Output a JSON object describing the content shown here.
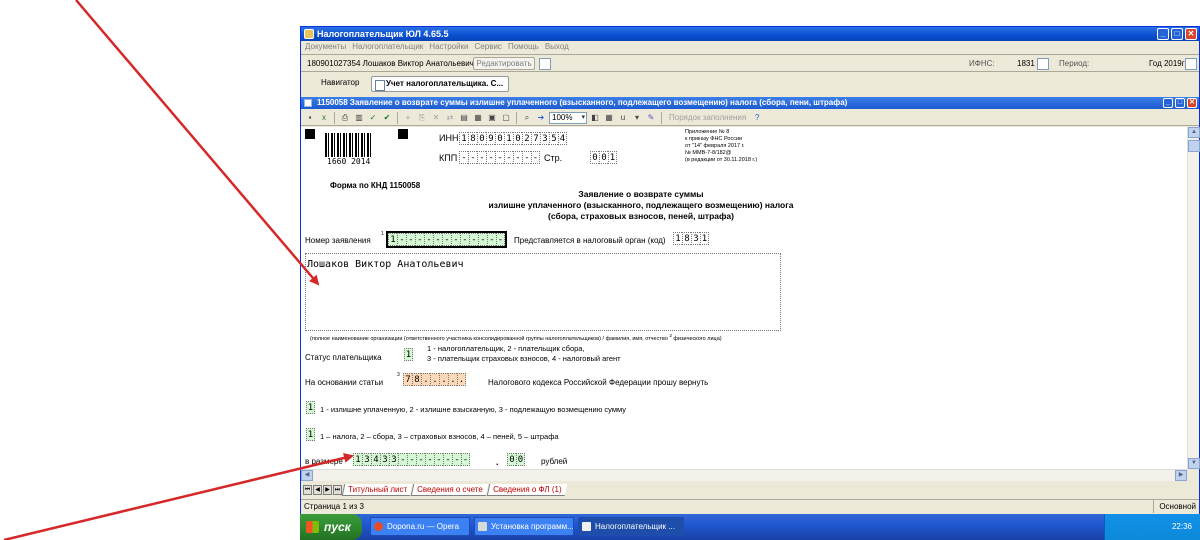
{
  "window": {
    "title": "Налогоплательщик ЮЛ 4.65.5",
    "min": "_",
    "max": "□",
    "close": "✕"
  },
  "menu": [
    "Документы",
    "Налогоплательщик",
    "Настройки",
    "Сервис",
    "Помощь",
    "Выход"
  ],
  "infobar": {
    "user": "180901027354 Лошаков Виктор Анатольевич",
    "edit_label": "Редактировать",
    "ifns_label": "ИФНС:",
    "ifns_value": "1831",
    "period_label": "Период:",
    "period_value": "Год 2019г"
  },
  "nav": {
    "navigator": "Навигатор",
    "active_tab": "Учет налогоплательщика. С..."
  },
  "doc": {
    "title": "1150058 Заявление о возврате суммы излишне уплаченного (взысканного, подлежащего возмещению) налога (сбора, пени, штрафа)",
    "zoom": "100%",
    "fill_order": "Порядок заполнения"
  },
  "form": {
    "barcode_number": "1660 2014",
    "inn_label": "ИНН",
    "inn": [
      "1",
      "8",
      "0",
      "9",
      "0",
      "1",
      "0",
      "2",
      "7",
      "3",
      "5",
      "4"
    ],
    "kpp_label": "КПП",
    "kpp": [
      "-",
      "-",
      "-",
      "-",
      "-",
      "-",
      "-",
      "-",
      "-"
    ],
    "page_label": "Стр.",
    "page": [
      "0",
      "0",
      "1"
    ],
    "appendix": [
      "Приложение № 8",
      "к приказу ФНС России",
      "от \"14\" февраля 2017 г.",
      "№ ММВ-7-8/182@",
      "(в редакции от 30.11.2018 г.)"
    ],
    "knd": "Форма по КНД 1150058",
    "heading": [
      "Заявление о возврате суммы",
      "излишне уплаченного (взысканного, подлежащего возмещению) налога",
      "(сбора, страховых взносов, пеней, штрафа)"
    ],
    "app_number_label": "Номер заявления",
    "app_number_sup": "1",
    "app_number": [
      "1",
      "-",
      "-",
      "-",
      "-",
      "-",
      "-",
      "-",
      "-",
      "-",
      "-",
      "-",
      "-"
    ],
    "tax_organ_label": "Представляется в налоговый орган (код)",
    "tax_organ": [
      "1",
      "8",
      "3",
      "1"
    ],
    "name": "Лошаков Виктор Анатольевич",
    "name_caption": "(полное наименование организации (ответственного участника консолидированной группы налогоплательщиков) / фамилия, имя, отчество",
    "name_caption_sup": "2",
    "name_caption_tail": "физического лица)",
    "status_label": "Статус плательщика",
    "status": [
      "1"
    ],
    "status_hint1": "1 - налогоплательщик, 2 - плательщик сбора,",
    "status_hint2": "3 - плательщик страховых взносов, 4 - налоговый агент",
    "article_label": "На основании статьи",
    "article_sup": "3",
    "article": [
      "7",
      "8",
      ".",
      ".",
      ".",
      ".",
      "."
    ],
    "article_tail": "Налогового кодекса Российской Федерации прошу вернуть",
    "kind": [
      "1"
    ],
    "kind_hint": "1 - излишне уплаченную, 2 - излишне взысканную, 3 - подлежащую возмещению сумму",
    "type": [
      "1"
    ],
    "type_hint": "1 – налога, 2 – сбора, 3 – страховых взносов, 4 – пеней, 5 – штрафа",
    "amount_label": "в размере",
    "amount": [
      "1",
      "3",
      "4",
      "3",
      "3",
      "-",
      "-",
      "-",
      "-",
      "-",
      "-",
      "-",
      "-"
    ],
    "amount_dot": ".",
    "amount_kop": [
      "0",
      "0"
    ],
    "amount_unit": "рублей"
  },
  "sheets": [
    "Титульный лист",
    "Сведения о счете",
    "Сведения о ФЛ (1)"
  ],
  "status": {
    "left": "Страница 1 из 3",
    "right": "Основной"
  },
  "taskbar": {
    "start": "пуск",
    "tasks": [
      "Dopona.ru — Opera",
      "Установка программ...",
      "Налогоплательщик ..."
    ],
    "clock": "22:36"
  },
  "colors": {
    "arrow": "#d62828",
    "green_cell": "#d4f7d4",
    "orange_cell": "#fbd9b8",
    "title_blue": "#0a4fd0"
  }
}
